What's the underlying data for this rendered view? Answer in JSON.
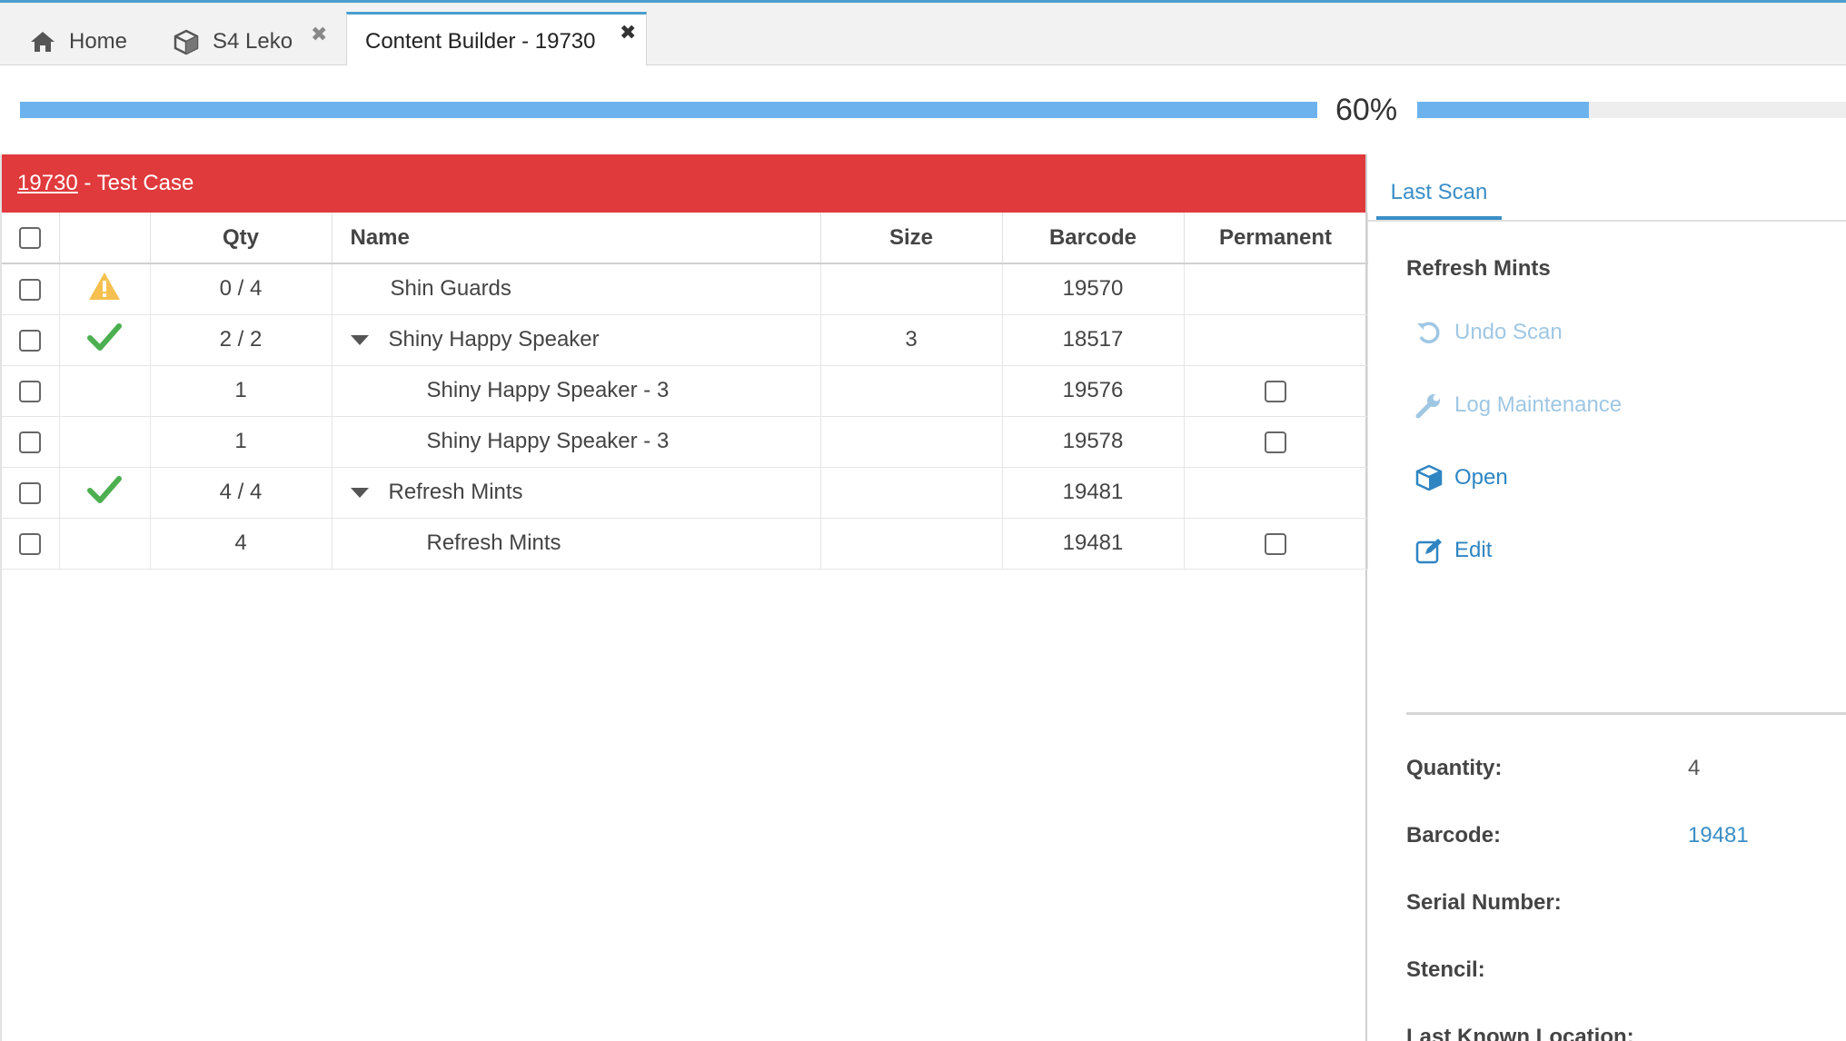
{
  "tabs": {
    "home": "Home",
    "s4": "S4 Leko",
    "active": "Content Builder - 19730"
  },
  "progress": {
    "percent_label": "60%",
    "overall_fraction": 1.0,
    "secondary_fraction": 0.4
  },
  "case": {
    "id": "19730",
    "suffix": " - Test Case",
    "header_color": "#e03a3c"
  },
  "table": {
    "headers": {
      "qty": "Qty",
      "name": "Name",
      "size": "Size",
      "barcode": "Barcode",
      "permanent": "Permanent"
    },
    "rows": [
      {
        "status": "warning",
        "qty": "0 / 4",
        "name": "Shin Guards",
        "expandable": false,
        "indent": 0,
        "size": "",
        "barcode": "19570",
        "permanent_box": false
      },
      {
        "status": "ok",
        "qty": "2 / 2",
        "name": "Shiny Happy Speaker",
        "expandable": true,
        "indent": 0,
        "size": "3",
        "barcode": "18517",
        "permanent_box": false
      },
      {
        "status": "",
        "qty": "1",
        "name": "Shiny Happy Speaker - 3",
        "expandable": false,
        "indent": 1,
        "size": "",
        "barcode": "19576",
        "permanent_box": true
      },
      {
        "status": "",
        "qty": "1",
        "name": "Shiny Happy Speaker - 3",
        "expandable": false,
        "indent": 1,
        "size": "",
        "barcode": "19578",
        "permanent_box": true
      },
      {
        "status": "ok",
        "qty": "4 / 4",
        "name": "Refresh Mints",
        "expandable": true,
        "indent": 0,
        "size": "",
        "barcode": "19481",
        "permanent_box": false
      },
      {
        "status": "",
        "qty": "4",
        "name": "Refresh Mints",
        "expandable": false,
        "indent": 1,
        "size": "",
        "barcode": "19481",
        "permanent_box": true
      }
    ]
  },
  "last_scan": {
    "tab_label": "Last Scan",
    "item_title": "Refresh Mints",
    "actions": {
      "undo": "Undo Scan",
      "log": "Log Maintenance",
      "open": "Open",
      "edit": "Edit"
    },
    "props": {
      "quantity_label": "Quantity:",
      "quantity_value": "4",
      "barcode_label": "Barcode:",
      "barcode_value": "19481",
      "serial_label": "Serial Number:",
      "stencil_label": "Stencil:",
      "location_label": "Last Known Location:"
    }
  },
  "colors": {
    "accent": "#3a8ec6",
    "progress": "#6cb3ee",
    "ok": "#4caf50",
    "warning": "#f5c04f"
  },
  "icons": {
    "home": "home-icon",
    "s4": "cube-icon",
    "undo": "undo-icon",
    "log": "wrench-icon",
    "open": "box-icon",
    "edit": "edit-icon"
  }
}
